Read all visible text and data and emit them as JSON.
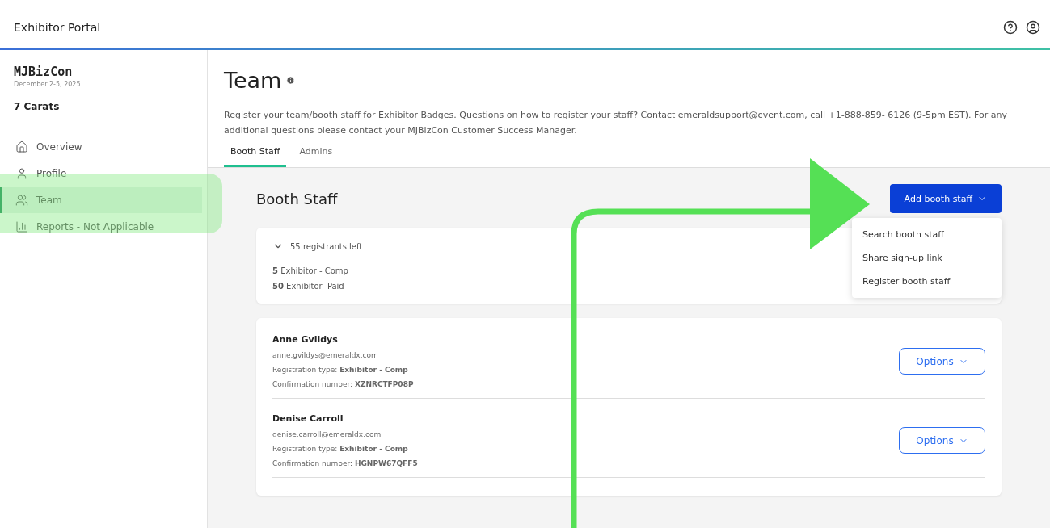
{
  "header": {
    "title": "Exhibitor Portal"
  },
  "sidebar": {
    "event": "MJBizCon",
    "dates": "December 2-5, 2025",
    "company": "7 Carats",
    "items": [
      {
        "label": "Overview",
        "selected": false
      },
      {
        "label": "Profile",
        "selected": false
      },
      {
        "label": "Team",
        "selected": true
      },
      {
        "label": "Reports - Not Applicable",
        "selected": false
      }
    ]
  },
  "page": {
    "title": "Team",
    "description": "Register your team/booth staff for Exhibitor Badges. Questions on how to register your staff? Contact emeraldsupport@cvent.com, call +1-888-859- 6126 (9-5pm EST). For any additional questions please contact your  MJBizCon  Customer Success Manager.",
    "tabs": [
      {
        "label": "Booth Staff",
        "selected": true
      },
      {
        "label": "Admins",
        "selected": false
      }
    ]
  },
  "section": {
    "title": "Booth Staff",
    "add_button": "Add booth staff",
    "menu": [
      "Search booth staff",
      "Share sign-up link",
      "Register booth staff"
    ],
    "summary": {
      "label": "55 registrants left",
      "expanded": true,
      "lines": [
        "**5** Exhibitor - Comp",
        "**50** Exhibitor- Paid"
      ]
    }
  },
  "staff": [
    {
      "name": "Anne Gvildys",
      "email": "anne.gvildys@emeraldx.com",
      "type": "Registration type: **Exhibitor - Comp**",
      "confirmation": "Confirmation number: **XZNRCTFP08P**",
      "button": "Options"
    },
    {
      "name": "Denise Carroll",
      "email": "denise.carroll@emeraldx.com",
      "type": "Registration type: **Exhibitor - Comp**",
      "confirmation": "Confirmation number: **HGNPW67QFF5**",
      "button": "Options"
    }
  ]
}
